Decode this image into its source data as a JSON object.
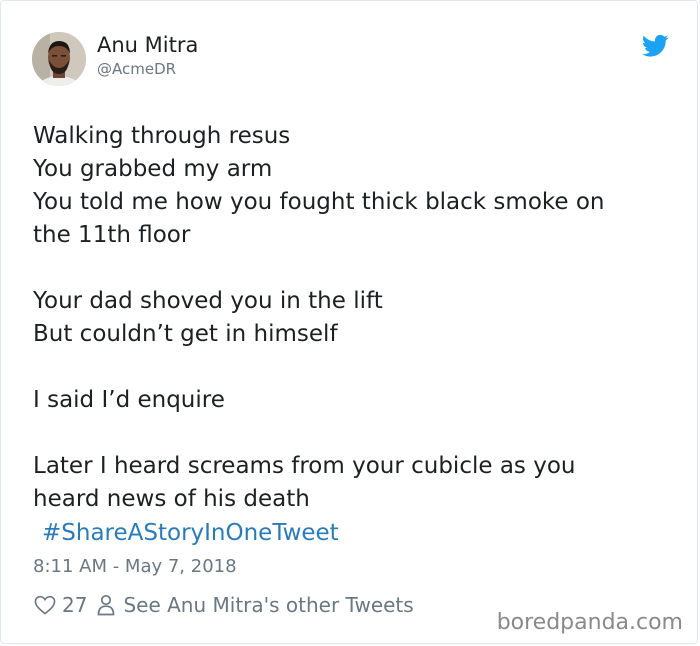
{
  "author": {
    "name": "Anu Mitra",
    "handle": "@AcmeDR",
    "avatar_icon": "profile-photo"
  },
  "tweet": {
    "lines": [
      "Walking through resus",
      "You grabbed my arm",
      "You told me how you fought thick black smoke on",
      "the 11th floor",
      "",
      "Your dad shoved you in the lift",
      "But couldn’t get in himself",
      "",
      "I said I’d enquire",
      "",
      "Later I heard screams from your cubicle as you",
      "heard news of his death"
    ],
    "hashtag": "#ShareAStoryInOneTweet",
    "timestamp": "8:11 AM - May 7, 2018"
  },
  "actions": {
    "like_count": "27",
    "like_icon": "heart-icon",
    "profile_icon": "person-icon",
    "other_tweets_label": "See Anu Mitra's other Tweets"
  },
  "brand": {
    "logo_icon": "twitter-bird-icon",
    "color": "#1da1f2",
    "hashtag_color": "#2b7bb9"
  },
  "watermark": "boredpanda.com"
}
